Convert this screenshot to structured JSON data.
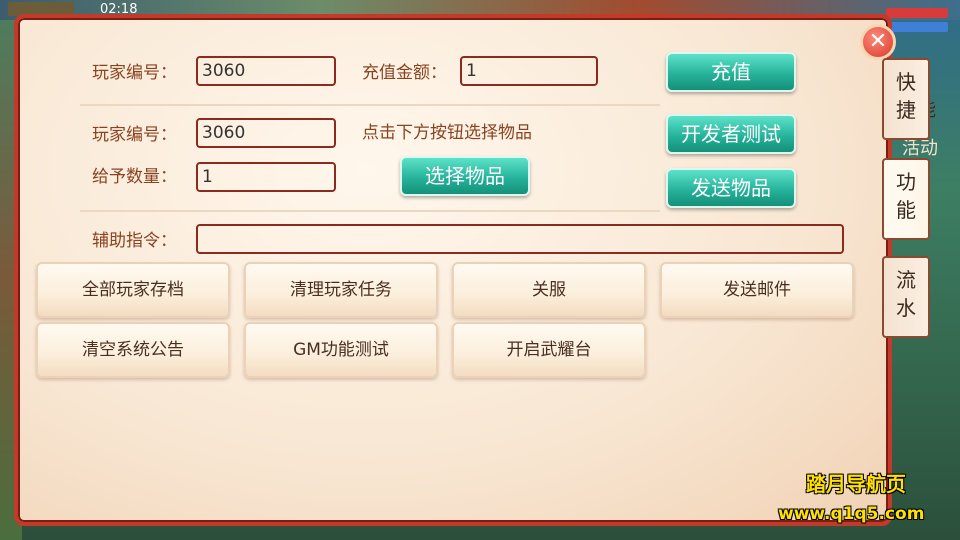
{
  "status": {
    "time": "02:18"
  },
  "recharge": {
    "player_id_label": "玩家编号：",
    "player_id_value": "3060",
    "amount_label": "充值金额：",
    "amount_value": "1",
    "recharge_button": "充值"
  },
  "item_send": {
    "player_id_label": "玩家编号：",
    "player_id_value": "3060",
    "hint": "点击下方按钮选择物品",
    "quantity_label": "给予数量：",
    "quantity_value": "1",
    "select_item_button": "选择物品",
    "dev_test_button": "开发者测试",
    "send_item_button": "发送物品"
  },
  "assist": {
    "label": "辅助指令：",
    "value": ""
  },
  "action_buttons": [
    "全部玩家存档",
    "清理玩家任务",
    "关服",
    "发送邮件",
    "清空系统公告",
    "GM功能测试",
    "开启武耀台"
  ],
  "side_tabs": [
    {
      "label": "快\n捷",
      "active": false
    },
    {
      "label": "功\n能",
      "active": true
    },
    {
      "label": "流\n水",
      "active": false
    }
  ],
  "background_labels": [
    "能",
    "活动"
  ],
  "watermark": {
    "line1": "踏月导航页",
    "line2": "www.q1q5.com"
  },
  "colors": {
    "panel_border": "#c43a2a",
    "primary_button": "#27b39c",
    "field_border": "#8b2a1e",
    "label_text": "#8a4320"
  }
}
